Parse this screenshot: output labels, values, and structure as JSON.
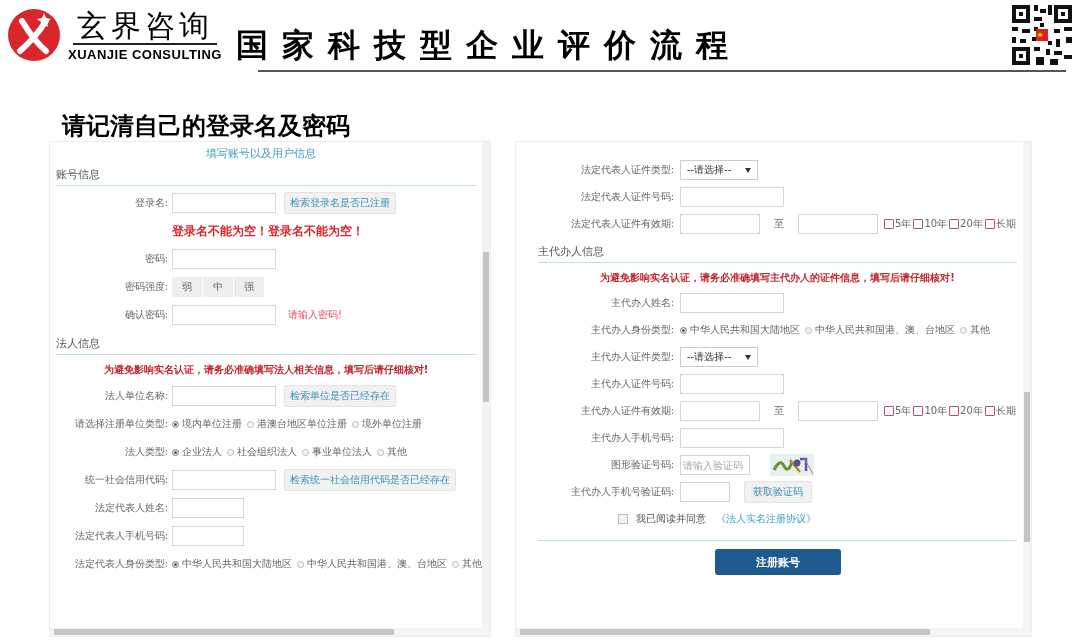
{
  "header": {
    "brand": "玄界咨询",
    "brand_en": "XUANJIE CONSULTING",
    "title": "国家科技型企业评价流程"
  },
  "subtitle": "请记清自己的登录名及密码",
  "left_form": {
    "title": "填写账号以及用户信息",
    "rows": [
      {
        "kind": "section",
        "label": "账号信息"
      },
      {
        "kind": "input",
        "label": "登录名:",
        "button": "检索登录名是否已注册"
      },
      {
        "kind": "error",
        "text": "登录名不能为空！登录名不能为空！"
      },
      {
        "kind": "input",
        "label": "密码:"
      },
      {
        "kind": "strength",
        "label": "密码强度:",
        "levels": [
          "弱",
          "中",
          "强"
        ]
      },
      {
        "kind": "input",
        "label": "确认密码:",
        "hint": "请输入密码!"
      },
      {
        "kind": "section",
        "label": "法人信息"
      },
      {
        "kind": "notice",
        "text": "为避免影响实名认证，请务必准确填写法人相关信息，填写后请仔细核对!"
      },
      {
        "kind": "input",
        "label": "法人单位名称:",
        "button": "检索单位是否已经存在"
      },
      {
        "kind": "radio",
        "label": "请选择注册单位类型:",
        "options": [
          {
            "label": "境内单位注册",
            "selected": true
          },
          {
            "label": "港澳台地区单位注册",
            "selected": false
          },
          {
            "label": "境外单位注册",
            "selected": false
          }
        ]
      },
      {
        "kind": "radio",
        "label": "法人类型:",
        "options": [
          {
            "label": "企业法人",
            "selected": true
          },
          {
            "label": "社会组织法人",
            "selected": false
          },
          {
            "label": "事业单位法人",
            "selected": false
          },
          {
            "label": "其他",
            "selected": false
          }
        ]
      },
      {
        "kind": "input",
        "label": "统一社会信用代码:",
        "button": "检索统一社会信用代码是否已经存在"
      },
      {
        "kind": "short",
        "label": "法定代表人姓名:"
      },
      {
        "kind": "short",
        "label": "法定代表人手机号码:"
      },
      {
        "kind": "radio",
        "label": "法定代表人身份类型:",
        "options": [
          {
            "label": "中华人民共和国大陆地区",
            "selected": true
          },
          {
            "label": "中华人民共和国港、澳、台地区",
            "selected": false
          },
          {
            "label": "其他",
            "selected": false
          }
        ]
      }
    ]
  },
  "right_form": {
    "rows": [
      {
        "kind": "select",
        "label": "法定代表人证件类型:",
        "value": "--请选择--"
      },
      {
        "kind": "input",
        "label": "法定代表人证件号码:"
      },
      {
        "kind": "period",
        "label": "法定代表人证件有效期:",
        "to": "至",
        "options": [
          {
            "label": "5年",
            "checked": false
          },
          {
            "label": "10年",
            "checked": false
          },
          {
            "label": "20年",
            "checked": false
          },
          {
            "label": "长期",
            "checked": false
          }
        ]
      },
      {
        "kind": "section",
        "label": "主代办人信息"
      },
      {
        "kind": "notice",
        "text": "为避免影响实名认证，请务必准确填写主代办人的证件信息，填写后请仔细核对!"
      },
      {
        "kind": "input",
        "label": "主代办人姓名:"
      },
      {
        "kind": "radio",
        "label": "主代办人身份类型:",
        "options": [
          {
            "label": "中华人民共和国大陆地区",
            "selected": true
          },
          {
            "label": "中华人民共和国港、澳、台地区",
            "selected": false
          },
          {
            "label": "其他",
            "selected": false
          }
        ]
      },
      {
        "kind": "select",
        "label": "主代办人证件类型:",
        "value": "--请选择--"
      },
      {
        "kind": "input",
        "label": "主代办人证件号码:"
      },
      {
        "kind": "period",
        "label": "主代办人证件有效期:",
        "to": "至",
        "options": [
          {
            "label": "5年",
            "checked": false
          },
          {
            "label": "10年",
            "checked": false
          },
          {
            "label": "20年",
            "checked": false
          },
          {
            "label": "长期",
            "checked": false
          }
        ]
      },
      {
        "kind": "input",
        "label": "主代办人手机号码:"
      },
      {
        "kind": "captcha",
        "label": "图形验证号码:",
        "placeholder": "请输入验证码"
      },
      {
        "kind": "tiny",
        "label": "主代办人手机号验证码:",
        "button": "获取验证码"
      },
      {
        "kind": "agree",
        "checked": false,
        "text": "我已阅读并同意",
        "link": "《法人实名注册协议》"
      }
    ],
    "submit": "注册账号"
  }
}
